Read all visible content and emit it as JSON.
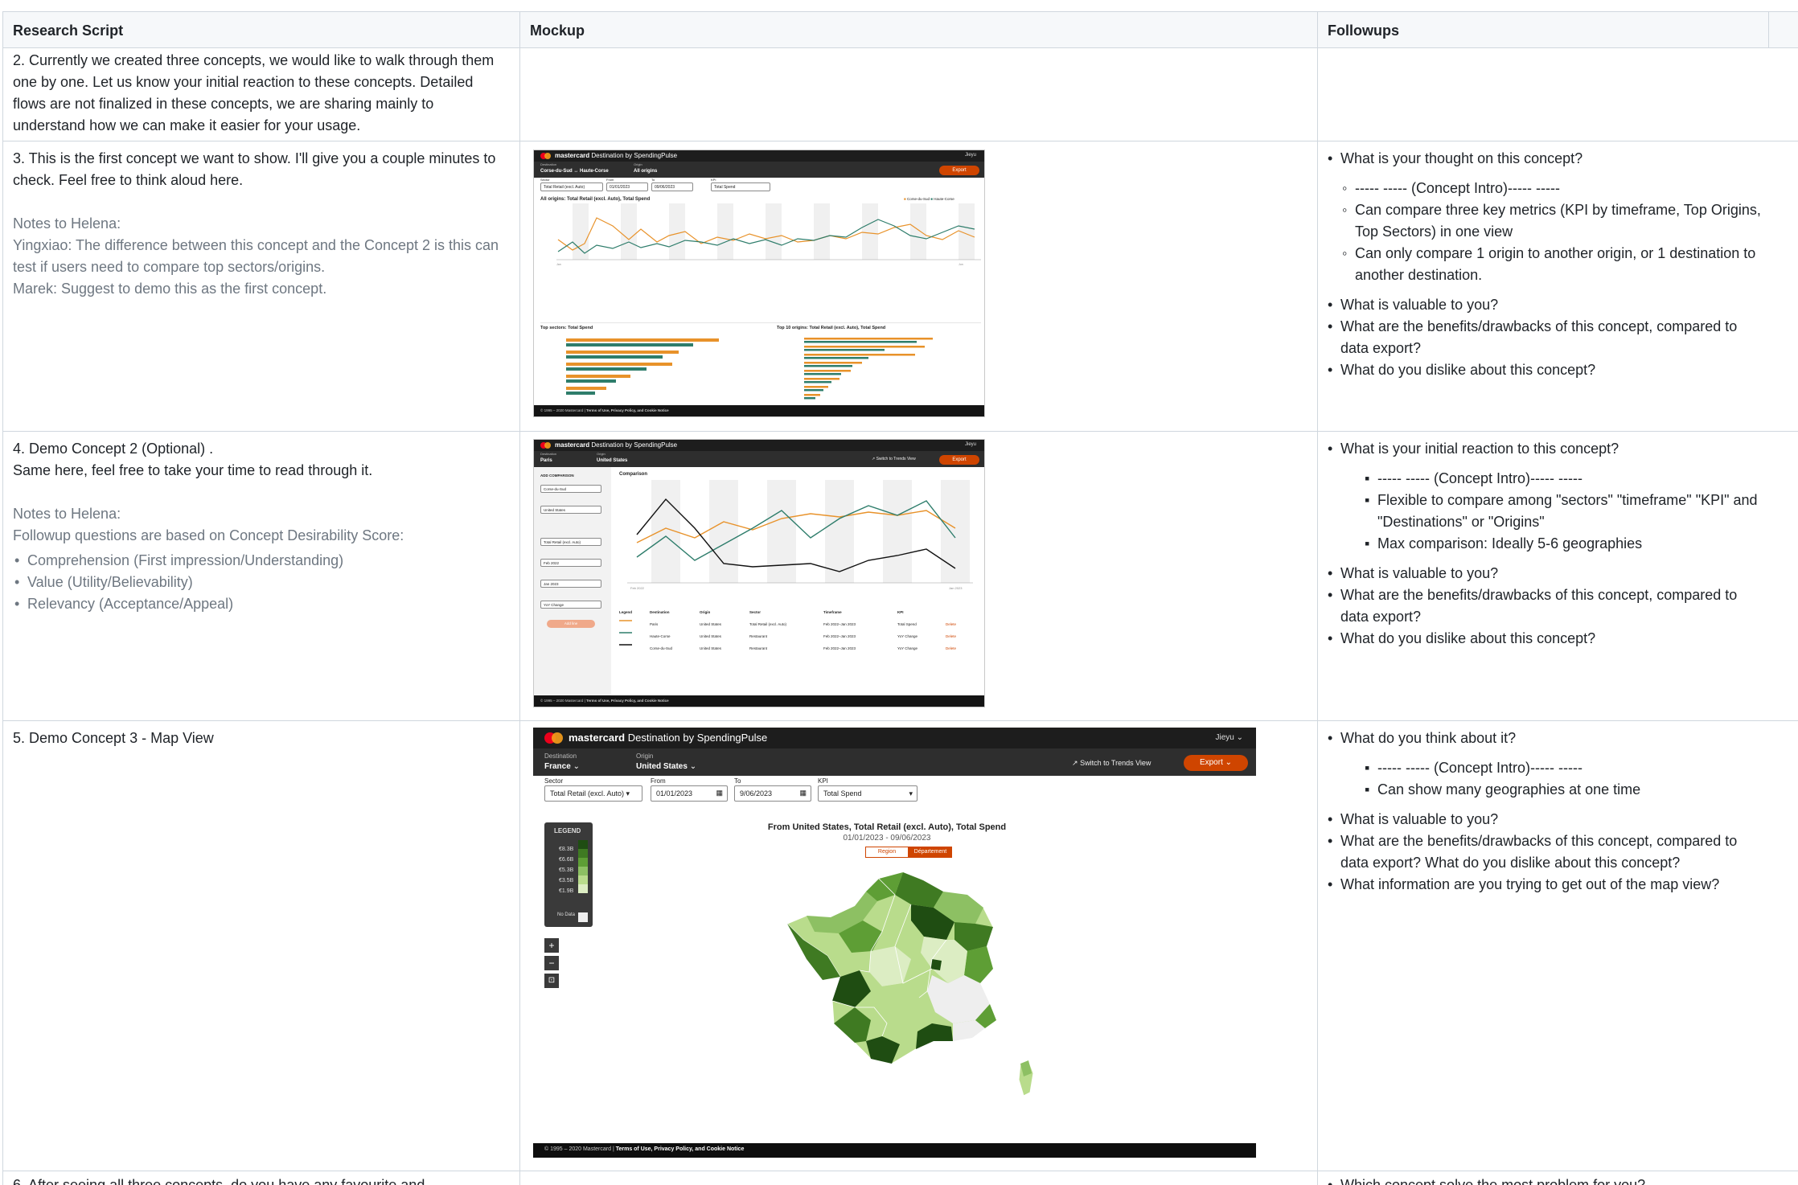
{
  "header": {
    "col1": "Research Script",
    "col2": "Mockup",
    "col3": "Followups"
  },
  "rows": [
    {
      "script": "2. Currently we created three concepts, we would like to walk through them one by one. Let us know your initial reaction to these concepts. Detailed flows are not finalized in these concepts, we are sharing mainly to understand how we can make it easier for your usage."
    },
    {
      "script": "3. This is the first concept we want to show. I'll give you a couple minutes to check. Feel free to think aloud here.",
      "notes_title": "Notes to Helena:",
      "notes": [
        "Yingxiao: The difference between this concept and the Concept 2 is this can test if users need to compare top sectors/origins.",
        "Marek: Suggest to demo this as the first concept."
      ],
      "followups_a": [
        "What is your thought on this concept?"
      ],
      "followups_sub": [
        "----- ----- (Concept Intro)----- -----",
        "Can compare three key metrics (KPI by timeframe, Top Origins, Top Sectors) in one view",
        "Can only compare 1 origin to another origin, or 1 destination to another destination."
      ],
      "followups_b": [
        "What is valuable to you?",
        "What are the benefits/drawbacks of this concept, compared to data export?",
        "What do you dislike about this concept?"
      ]
    },
    {
      "script": "4.  Demo Concept 2 (Optional) .\nSame here, feel free to take your time to read through it.",
      "notes_title": "Notes to Helena:",
      "notes_intro": "Followup questions are based on Concept Desirability Score:",
      "notes_list": [
        "Comprehension (First impression/Understanding)",
        "Value (Utility/Believability)",
        "Relevancy (Acceptance/Appeal)"
      ],
      "followups_a": [
        "What is your initial reaction to this concept?"
      ],
      "followups_sub": [
        "----- ----- (Concept Intro)----- -----",
        "Flexible to compare among \"sectors\" \"timeframe\" \"KPI\" and \"Destinations\" or \"Origins\"",
        "Max comparison: Ideally 5-6 geographies"
      ],
      "followups_b": [
        "What is valuable to you?",
        "What are the benefits/drawbacks of this concept, compared to data export?",
        "What do you dislike about this concept?"
      ]
    },
    {
      "script": "5. Demo Concept 3 - Map View",
      "followups_a": [
        "What do you think about it?"
      ],
      "followups_sub": [
        "----- ----- (Concept Intro)----- -----",
        "Can show many geographies at one time"
      ],
      "followups_b": [
        "What is valuable to you?",
        "What are the benefits/drawbacks of this concept, compared to data export? What do you dislike about this concept?",
        "What information are you trying to get out of the map view?"
      ]
    }
  ],
  "next_row": {
    "script": "6. After seeing all three concepts, do you have any favourite and ...",
    "followup": "Which concept solve the most problem for you?"
  },
  "mockup": {
    "brand_main": "mastercard",
    "brand_sub": "Destination by SpendingPulse",
    "user": "Jieyu",
    "export": "Export",
    "switch_trends": "Switch to Trends View",
    "footer_copy": "© 1995 – 2020 Mastercard",
    "footer_links": "Terms of Use, Privacy Policy, and Cookie Notice",
    "c1": {
      "dest_label": "Destination",
      "dest_value": "Corse-du-Sud ↔ Haute-Corse",
      "origin_label": "Origin",
      "origin_value": "All origins",
      "sector_label": "Sector",
      "sector_value": "Total Retail (excl. Auto)",
      "from_label": "From",
      "from_value": "01/01/2023",
      "to_label": "To",
      "to_value": "09/06/2023",
      "kpi_label": "KPI",
      "kpi_value": "Total Spend",
      "chart_title": "All origins: Total Retail (excl. Auto), Total Spend",
      "legend": [
        "Corse-du-Sud",
        "Haute-Corse"
      ],
      "sectors_title": "Top sectors: Total Spend",
      "origins_title": "Top 10 origins: Total Retail (excl. Auto), Total Spend"
    },
    "c2": {
      "dest_label": "Destination",
      "dest_value": "Paris",
      "origin_label": "Origin",
      "origin_value": "United States",
      "add_title": "ADD COMPARISON",
      "side_fields": [
        "Corse-du-Sud",
        "United States",
        "Total Retail (excl. Auto)",
        "Feb 2022",
        "Jan 2023",
        "YoY Change"
      ],
      "add_btn": "Add line",
      "chart_title": "Comparison",
      "table_head": [
        "Legend",
        "Destination",
        "Origin",
        "Sector",
        "Timeframe",
        "KPI"
      ],
      "table_rows": [
        [
          "Paris",
          "United States",
          "Total Retail (excl. Auto)",
          "Feb 2022–Jan 2023",
          "Total Spend",
          "Delete"
        ],
        [
          "Haute-Corse",
          "United States",
          "Restaurant",
          "Feb 2022–Jan 2023",
          "YoY Change",
          "Delete"
        ],
        [
          "Corse-du-Sud",
          "United States",
          "Restaurant",
          "Feb 2022–Jan 2023",
          "YoY Change",
          "Delete"
        ]
      ]
    },
    "c3": {
      "dest_label": "Destination",
      "dest_value": "France",
      "origin_label": "Origin",
      "origin_value": "United States",
      "sector_label": "Sector",
      "sector_value": "Total Retail (excl. Auto)",
      "from_label": "From",
      "from_value": "01/01/2023",
      "to_label": "To",
      "to_value": "9/06/2023",
      "kpi_label": "KPI",
      "kpi_value": "Total Spend",
      "legend_title": "LEGEND",
      "legend_values": [
        "€8.3B",
        "€6.6B",
        "€5.3B",
        "€3.5B",
        "€1.9B"
      ],
      "legend_nodata": "No Data",
      "map_title": "From United States, Total Retail (excl. Auto), Total Spend",
      "map_dates": "01/01/2023 - 09/06/2023",
      "toggle_region": "Region",
      "toggle_dept": "Département",
      "zoom_in": "+",
      "zoom_out": "−"
    }
  },
  "colors": {
    "orange": "#e8922a",
    "teal": "#2e7d6b",
    "brand_orange": "#cf4500",
    "border": "#d0d7de",
    "header_bg": "#f6f8fa"
  }
}
